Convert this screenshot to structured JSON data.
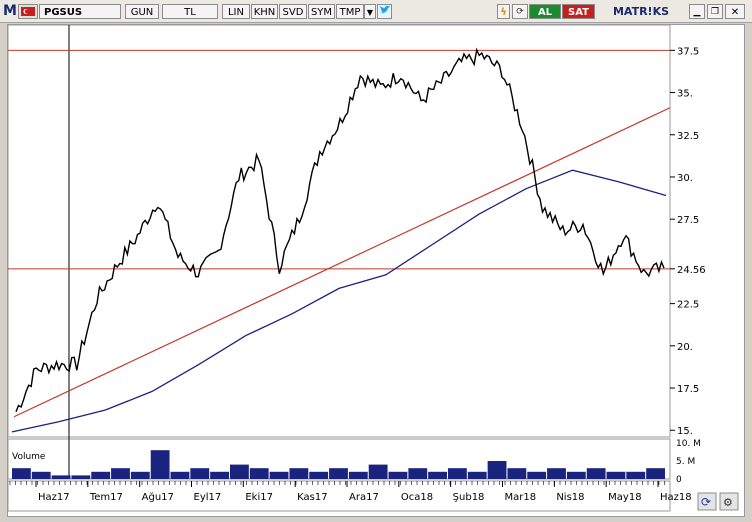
{
  "toolbar": {
    "symbol": "PGSUS",
    "period": "GUN",
    "currency": "TL",
    "scale_lin": "LIN",
    "khn": "KHN",
    "svd": "SVD",
    "sym": "SYM",
    "tmp": "TMP",
    "buy": "AL",
    "sell": "SAT",
    "brand": "MATR!KS",
    "colors": {
      "buy": "#1e8a2e",
      "sell": "#c81e1e",
      "brand": "#1a2a6c",
      "twitter": "#1da1f2"
    },
    "icons": [
      "m-logo-icon",
      "flag-icon",
      "dropdown-icon",
      "twitter-icon",
      "lightning-icon",
      "refresh-icon",
      "minimize-icon",
      "restore-icon",
      "close-icon"
    ]
  },
  "chart_data": {
    "type": "line",
    "symbol": "PGSUS",
    "y_ticks": [
      "15.",
      "17.5",
      "20.",
      "22.5",
      "24.56",
      "27.5",
      "30.",
      "32.5",
      "35.",
      "37.5"
    ],
    "y_tick_values": [
      15,
      17.5,
      20,
      22.5,
      25,
      27.5,
      30,
      32.5,
      35,
      37.5
    ],
    "current_value_label": "24.56",
    "current_value": 24.56,
    "ylim": [
      14.6,
      39.0
    ],
    "x_ticks": [
      "Haz17",
      "Tem17",
      "Ağu17",
      "Eyl17",
      "Eki17",
      "Kas17",
      "Ara17",
      "Oca18",
      "Şub18",
      "Mar18",
      "Nis18",
      "May18",
      "Haz18"
    ],
    "horizontal_lines": [
      37.5,
      24.56
    ],
    "trendline": {
      "from": [
        "Haz17",
        15.8
      ],
      "to": [
        "Haz18",
        34.1
      ]
    },
    "moving_average": [
      14.9,
      15.5,
      16.2,
      17.3,
      18.9,
      20.6,
      21.9,
      23.4,
      24.2,
      26.0,
      27.8,
      29.3,
      30.4,
      29.7,
      28.9
    ],
    "price": [
      16.1,
      18.6,
      18.9,
      18.9,
      22.8,
      24.8,
      26.5,
      28.6,
      25.3,
      24.3,
      25.6,
      30.0,
      31.0,
      24.7,
      27.6,
      31.5,
      33.2,
      36.0,
      35.3,
      36.1,
      34.5,
      35.6,
      36.8,
      37.2,
      36.3,
      33.0,
      28.2,
      26.8,
      27.2,
      24.3,
      26.6,
      24.3,
      24.6
    ],
    "volume_panel": {
      "label": "Volume",
      "ticks": [
        "10. M",
        "5. M",
        "0"
      ]
    },
    "volume": [
      3,
      2,
      1,
      1,
      2,
      3,
      2,
      8,
      2,
      3,
      2,
      4,
      3,
      2,
      3,
      2,
      3,
      2,
      4,
      2,
      3,
      2,
      3,
      2,
      5,
      3,
      2,
      3,
      2,
      3,
      2,
      2,
      3
    ],
    "colors": {
      "price": "#000000",
      "moving_average": "#1a237e",
      "trendline": "#c0392b",
      "hlines": "#c0392b",
      "volume": "#1a237e"
    }
  }
}
